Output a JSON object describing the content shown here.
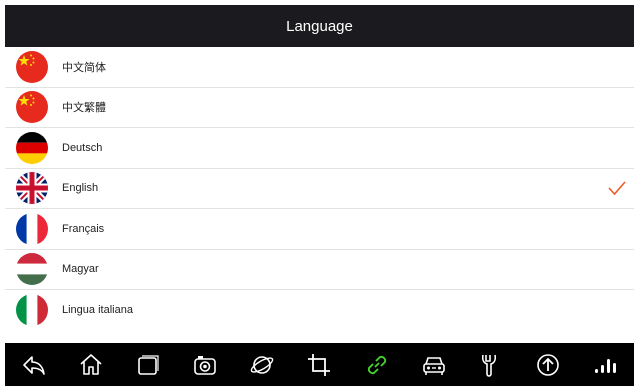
{
  "header": {
    "title": "Language"
  },
  "languages": [
    {
      "label": "中文简体",
      "flag": "china-flag-icon",
      "selected": false
    },
    {
      "label": "中文繁體",
      "flag": "china-flag-icon",
      "selected": false
    },
    {
      "label": "Deutsch",
      "flag": "germany-flag-icon",
      "selected": false
    },
    {
      "label": "English",
      "flag": "uk-flag-icon",
      "selected": true
    },
    {
      "label": "Français",
      "flag": "france-flag-icon",
      "selected": false
    },
    {
      "label": "Magyar",
      "flag": "hungary-flag-icon",
      "selected": false
    },
    {
      "label": "Lingua italiana",
      "flag": "italy-flag-icon",
      "selected": false
    }
  ],
  "colors": {
    "header_bg": "#1b1b1f",
    "check": "#f05a28",
    "link_icon": "#44d62c",
    "nav_bg": "#000000"
  },
  "nav": {
    "items": [
      "back-icon",
      "home-icon",
      "recent-apps-icon",
      "camera-icon",
      "browser-icon",
      "crop-icon",
      "link-icon",
      "vehicle-icon",
      "wrench-icon",
      "upload-icon",
      "signal-bars-icon"
    ]
  }
}
